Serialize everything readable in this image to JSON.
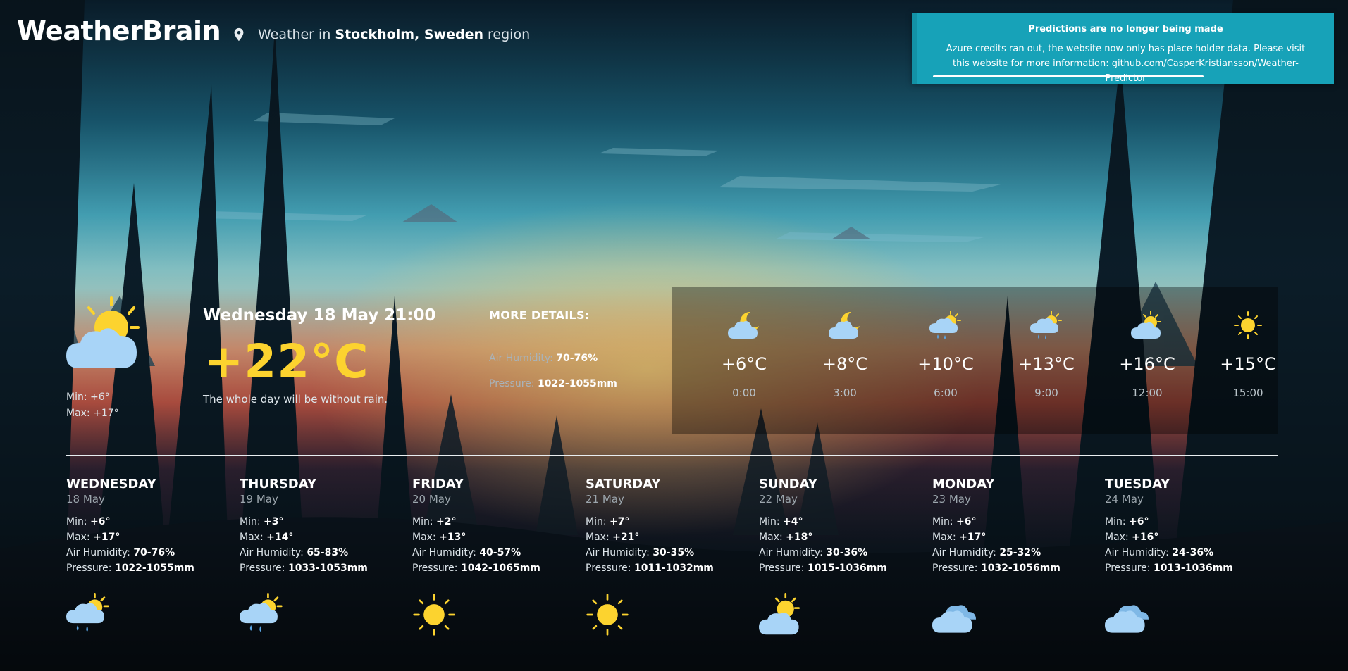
{
  "header": {
    "brand": "WeatherBrain",
    "location_prefix": "Weather in",
    "location_city": "Stockholm, Sweden",
    "location_suffix": "region"
  },
  "toast": {
    "title": "Predictions are no longer being made",
    "body": "Azure credits ran out, the website now only has place holder data. Please visit this website for more information: github.com/CasperKristiansson/Weather-Predictor",
    "color": "#17a2b8",
    "progress": 0.65
  },
  "current": {
    "icon": "sun-cloud-icon",
    "min_label": "Min:",
    "min": "+6°",
    "max_label": "Max:",
    "max": "+17°",
    "datetime": "Wednesday 18 May 21:00",
    "temperature": "+22°C",
    "description": "The whole day will be without rain.",
    "temp_color": "#fcd32f"
  },
  "details": {
    "heading": "MORE DETAILS:",
    "humidity_label": "Air Humidity:",
    "humidity": "70-76%",
    "pressure_label": "Pressure:",
    "pressure": "1022-1055mm"
  },
  "hourly": [
    {
      "icon": "moon-cloud-icon",
      "temp": "+6°C",
      "time": "0:00"
    },
    {
      "icon": "moon-cloud-icon",
      "temp": "+8°C",
      "time": "3:00"
    },
    {
      "icon": "sun-rain-cloud-icon",
      "temp": "+10°C",
      "time": "6:00"
    },
    {
      "icon": "sun-rain-cloud-icon",
      "temp": "+13°C",
      "time": "9:00"
    },
    {
      "icon": "sun-cloud-icon",
      "temp": "+16°C",
      "time": "12:00"
    },
    {
      "icon": "sun-icon",
      "temp": "+15°C",
      "time": "15:00"
    }
  ],
  "daily": [
    {
      "name": "Wednesday",
      "date": "18 May",
      "min": "+6°",
      "max": "+17°",
      "humidity": "70-76%",
      "pressure": "1022-1055mm",
      "icon": "sun-rain-cloud-icon"
    },
    {
      "name": "Thursday",
      "date": "19 May",
      "min": "+3°",
      "max": "+14°",
      "humidity": "65-83%",
      "pressure": "1033-1053mm",
      "icon": "sun-rain-cloud-icon"
    },
    {
      "name": "Friday",
      "date": "20 May",
      "min": "+2°",
      "max": "+13°",
      "humidity": "40-57%",
      "pressure": "1042-1065mm",
      "icon": "sun-icon"
    },
    {
      "name": "Saturday",
      "date": "21 May",
      "min": "+7°",
      "max": "+21°",
      "humidity": "30-35%",
      "pressure": "1011-1032mm",
      "icon": "sun-icon"
    },
    {
      "name": "Sunday",
      "date": "22 May",
      "min": "+4°",
      "max": "+18°",
      "humidity": "30-36%",
      "pressure": "1015-1036mm",
      "icon": "sun-cloud-icon"
    },
    {
      "name": "Monday",
      "date": "23 May",
      "min": "+6°",
      "max": "+17°",
      "humidity": "25-32%",
      "pressure": "1032-1056mm",
      "icon": "cloud-icon"
    },
    {
      "name": "Tuesday",
      "date": "24 May",
      "min": "+6°",
      "max": "+16°",
      "humidity": "24-36%",
      "pressure": "1013-1036mm",
      "icon": "cloud-icon"
    }
  ],
  "labels": {
    "min": "Min:",
    "max": "Max:",
    "humidity": "Air Humidity:",
    "pressure": "Pressure:"
  },
  "colors": {
    "sun": "#fcd32f",
    "cloud": "#a8d4f7",
    "rain": "#5aa6e6"
  }
}
